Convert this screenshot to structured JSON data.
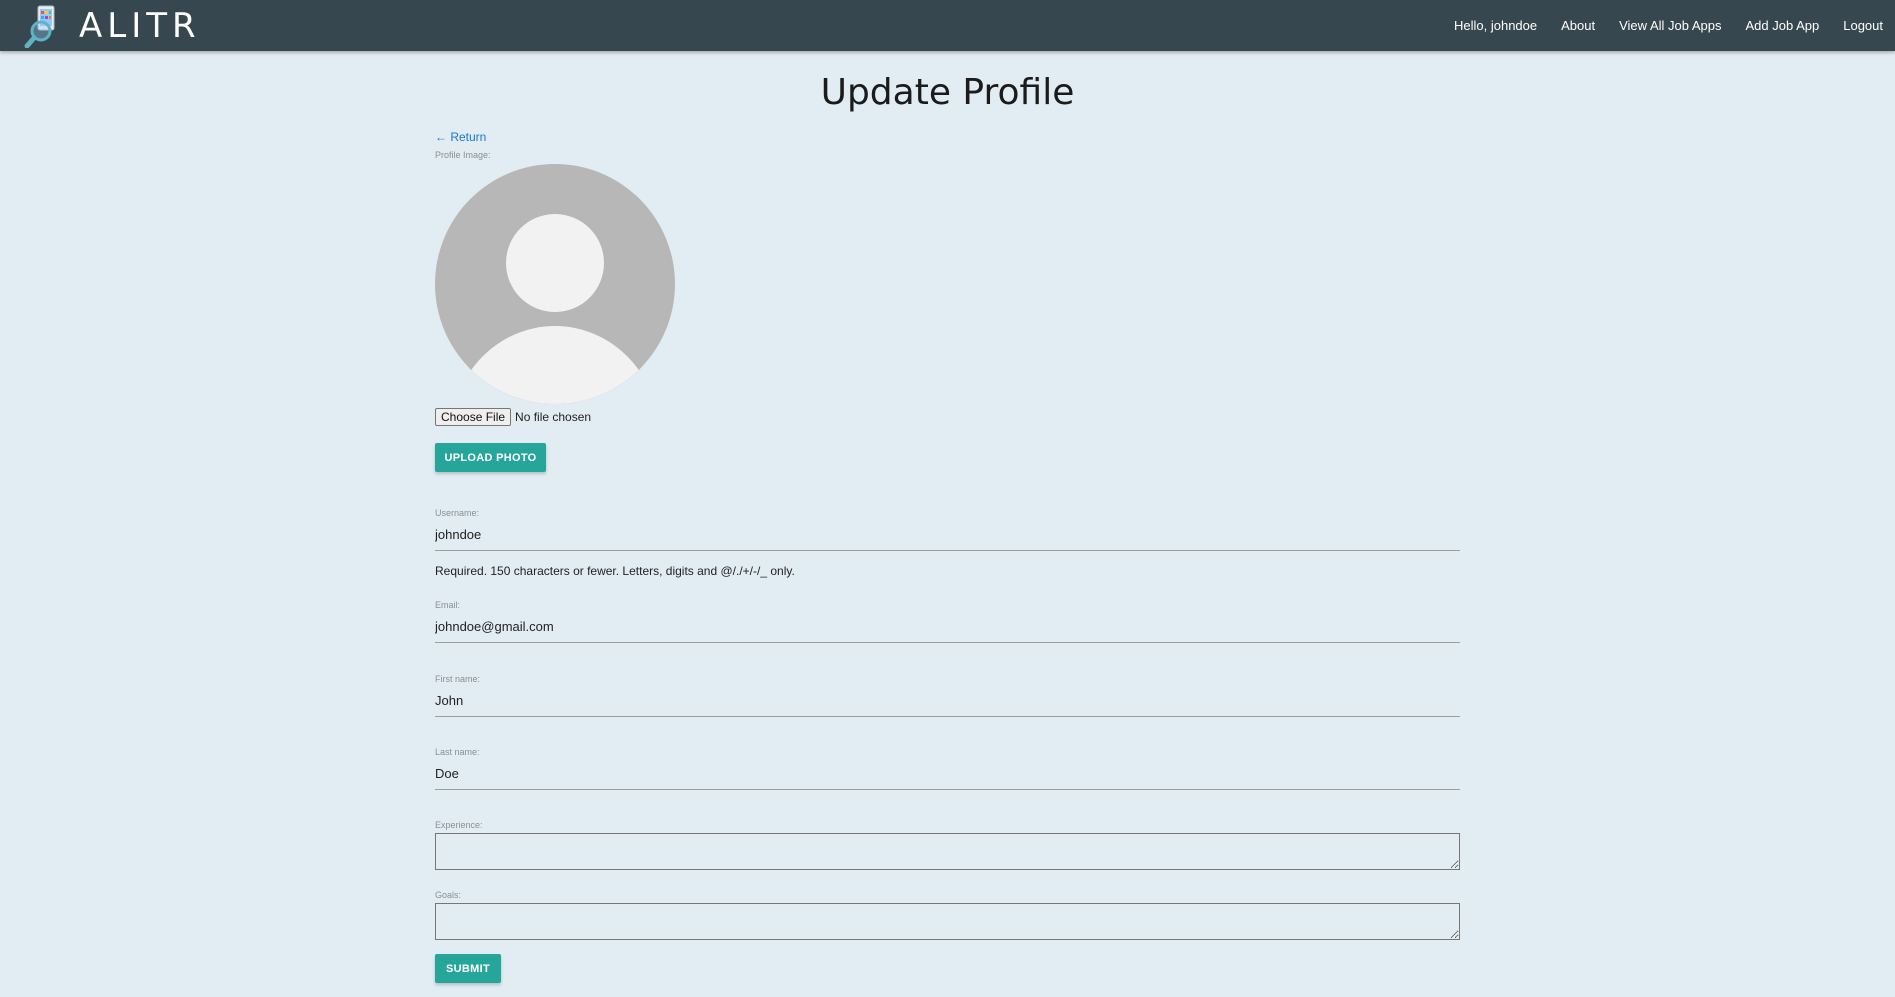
{
  "app": {
    "brand": "ALITR"
  },
  "nav": {
    "greeting": "Hello, johndoe",
    "about": "About",
    "view_all": "View All Job Apps",
    "add_job": "Add Job App",
    "logout": "Logout"
  },
  "page": {
    "title": "Update Profile",
    "return_link": "← Return"
  },
  "profile_image": {
    "label": "Profile Image:",
    "choose_file": "Choose File",
    "file_status": "No file chosen",
    "upload_button": "UPLOAD PHOTO"
  },
  "form": {
    "username": {
      "label": "Username:",
      "value": "johndoe",
      "help": "Required. 150 characters or fewer. Letters, digits and @/./+/-/_ only."
    },
    "email": {
      "label": "Email:",
      "value": "johndoe@gmail.com"
    },
    "first_name": {
      "label": "First name:",
      "value": "John"
    },
    "last_name": {
      "label": "Last name:",
      "value": "Doe"
    },
    "experience": {
      "label": "Experience:",
      "value": ""
    },
    "goals": {
      "label": "Goals:",
      "value": ""
    },
    "submit_button": "SUBMIT"
  },
  "colors": {
    "navbar": "#37474f",
    "background": "#e2edf3",
    "accent": "#26a69a",
    "link": "#1976d2"
  }
}
